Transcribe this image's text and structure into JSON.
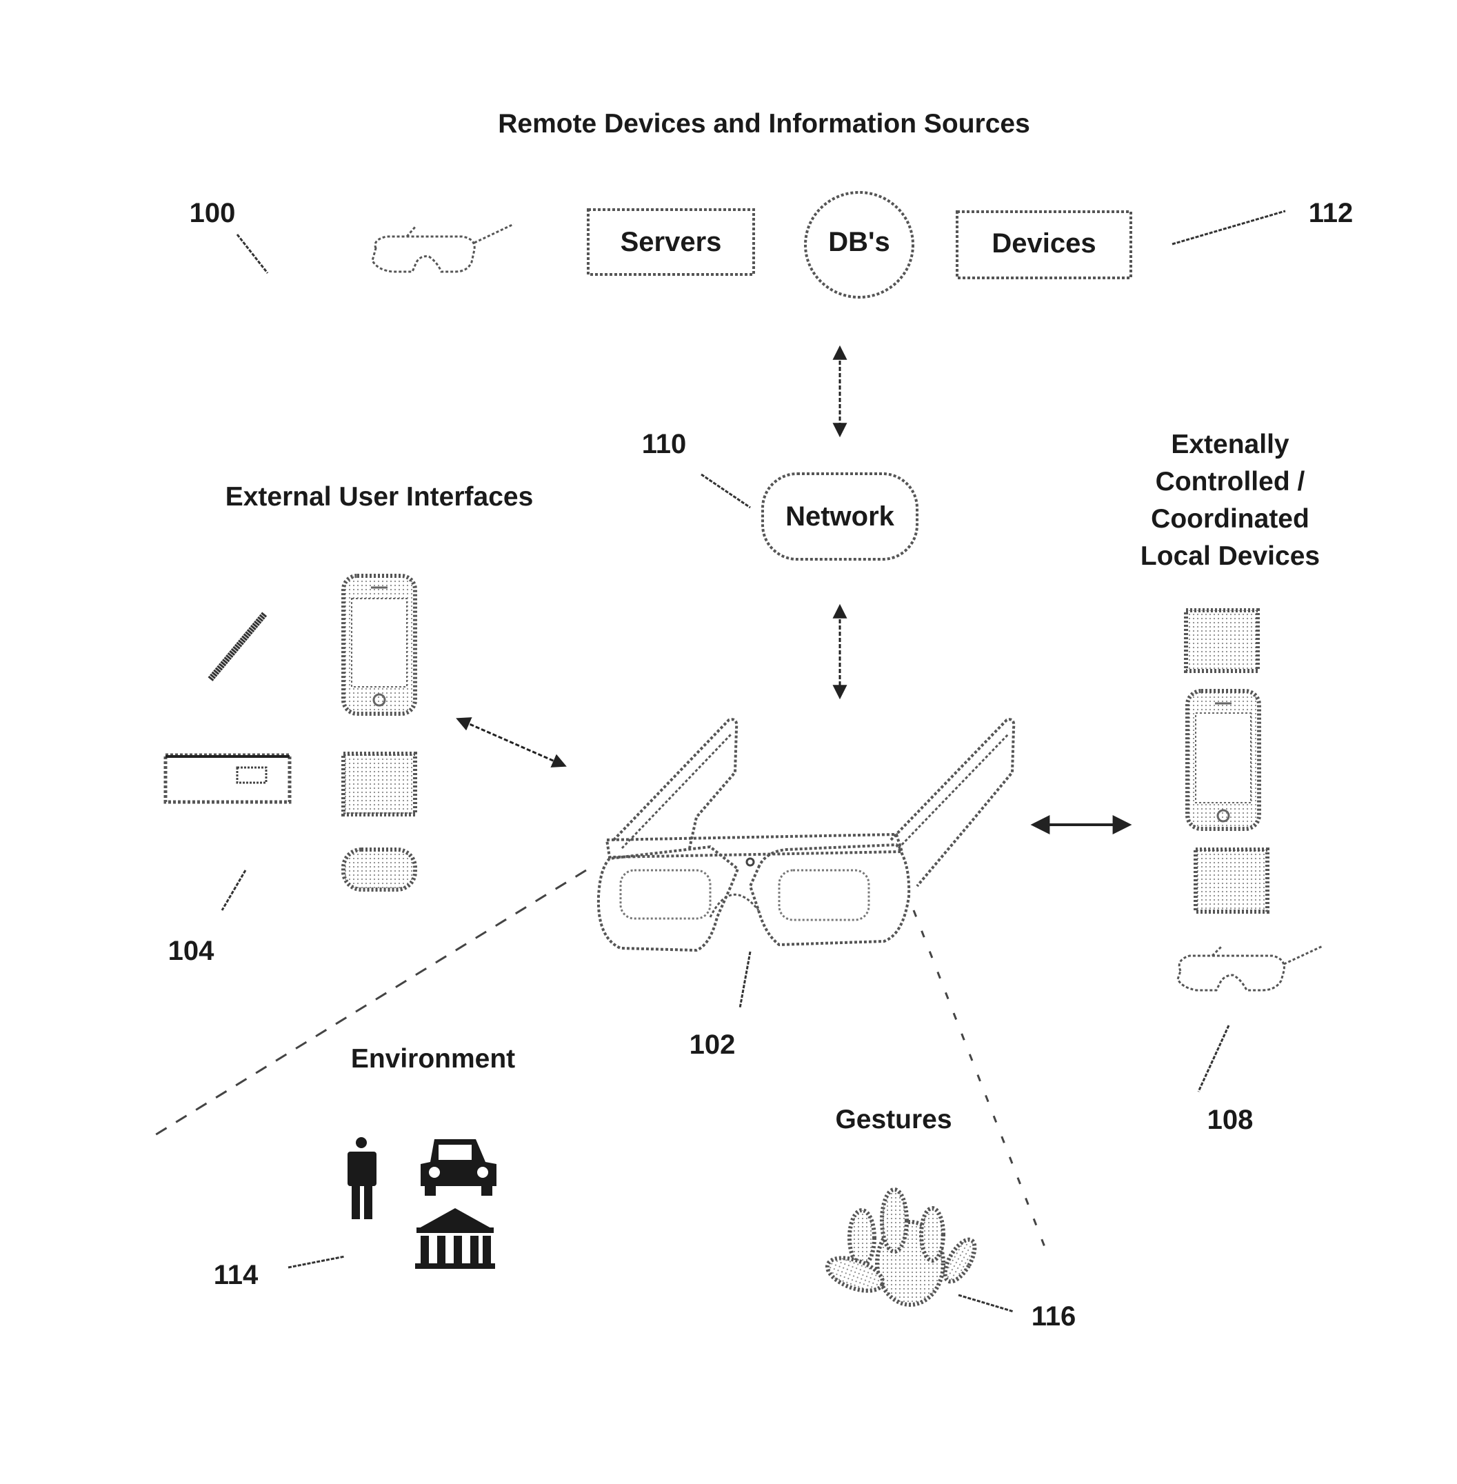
{
  "title": "Remote Devices and Information Sources",
  "remote": {
    "servers_label": "Servers",
    "dbs_label": "DB's",
    "devices_label": "Devices"
  },
  "network_label": "Network",
  "sections": {
    "external_ui": "External User Interfaces",
    "local_devices": [
      "Extenally",
      "Controlled /",
      "Coordinated",
      "Local Devices"
    ],
    "environment": "Environment",
    "gestures": "Gestures"
  },
  "refs": {
    "r100": "100",
    "r102": "102",
    "r104": "104",
    "r108": "108",
    "r110": "110",
    "r112": "112",
    "r114": "114",
    "r116": "116"
  },
  "icons": {
    "remote_glasses": "glasses-icon",
    "stylus": "stylus-icon",
    "phone": "smartphone-icon",
    "keyboard": "keyboard-device-icon",
    "pad": "square-device-icon",
    "pebble": "rounded-device-icon",
    "person": "person-icon",
    "car": "car-icon",
    "building": "building-icon",
    "hand": "hand-icon"
  }
}
